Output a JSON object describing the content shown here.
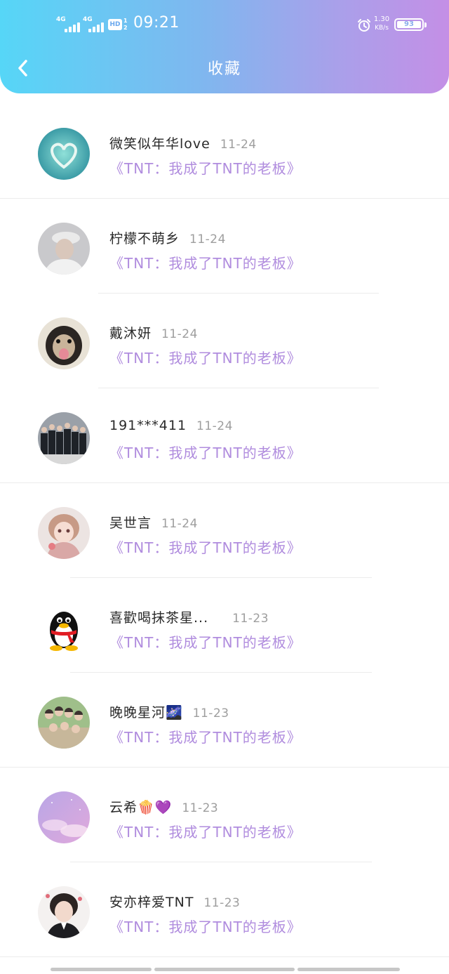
{
  "status": {
    "signal1": "4G",
    "signal2": "4G",
    "hd": "HD",
    "hd_sub": "1 2",
    "time": "09:21",
    "speed_value": "1.30",
    "speed_unit": "KB/s",
    "battery": "93"
  },
  "header": {
    "title": "收藏"
  },
  "colors": {
    "accent": "#b08cde",
    "gradient_start": "#56d6f7",
    "gradient_end": "#c48fe6"
  },
  "items": [
    {
      "name": "微笑似年华love",
      "date": "11-24",
      "book": "《TNT：我成了TNT的老板》",
      "avatar": "heart-island"
    },
    {
      "name": "柠檬不萌乡",
      "date": "11-24",
      "book": "《TNT：我成了TNT的老板》",
      "avatar": "boy-cap"
    },
    {
      "name": "戴沐妍",
      "date": "11-24",
      "book": "《TNT：我成了TNT的老板》",
      "avatar": "dog"
    },
    {
      "name": "191***411",
      "date": "11-24",
      "book": "《TNT：我成了TNT的老板》",
      "avatar": "group-suits"
    },
    {
      "name": "吴世言",
      "date": "11-24",
      "book": "《TNT：我成了TNT的老板》",
      "avatar": "anime-girl"
    },
    {
      "name": "喜歡喝抹茶星...",
      "date": "11-23",
      "book": "《TNT：我成了TNT的老板》",
      "avatar": "qq-penguin"
    },
    {
      "name": "晚晚星河🌌",
      "date": "11-23",
      "book": "《TNT：我成了TNT的老板》",
      "avatar": "group-photo"
    },
    {
      "name": "云希🍿💜",
      "date": "11-23",
      "book": "《TNT：我成了TNT的老板》",
      "avatar": "purple-sky"
    },
    {
      "name": "安亦梓爱TNT",
      "date": "11-23",
      "book": "《TNT：我成了TNT的老板》",
      "avatar": "boy-portrait"
    }
  ]
}
